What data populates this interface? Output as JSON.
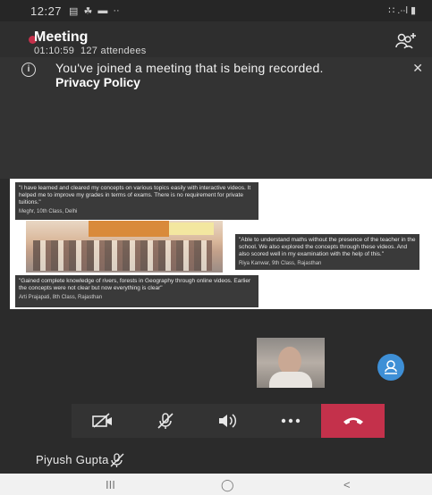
{
  "status_bar": {
    "time": "12:27",
    "left_icons": [
      "▤",
      "☘",
      "▬",
      "··"
    ],
    "right_icons": "∷ .∙∙l ▮"
  },
  "meeting": {
    "title": "Meeting",
    "elapsed": "01:10:59",
    "attendees": "127 attendees",
    "recording_color": "#c4314b"
  },
  "banner": {
    "message": "You've joined a meeting that is being recorded.",
    "link": "Privacy Policy",
    "close": "✕"
  },
  "shared_screen": {
    "quote1": "\"I have learned and cleared my concepts on various topics easily with interactive videos. It helped me to improve my grades in terms of exams. There is no requirement for private tuitions.\"",
    "quote1_author": "Meghr, 10th Class, Delhi",
    "quote2": "\"Able to understand maths without the presence of the teacher in the school. We also explored the concepts through these videos. And also scored well in my examination with the help of this.\"",
    "quote2_author": "Riya Kanwar, 9th Class, Rajasthan",
    "quote3": "\"Gained complete knowledge of rivers, forests in Geography through online videos. Earlier the concepts were not clear but now everything is clear\"",
    "quote3_author": "Arti Prajapati, 8th Class, Rajasthan"
  },
  "participant": {
    "name": "Piyush Gupta",
    "mic_state": "muted"
  },
  "controls": {
    "hangup_color": "#c4314b",
    "bar_color": "#333333"
  },
  "nav": {
    "recents": "III",
    "home": "◯",
    "back": "<"
  }
}
